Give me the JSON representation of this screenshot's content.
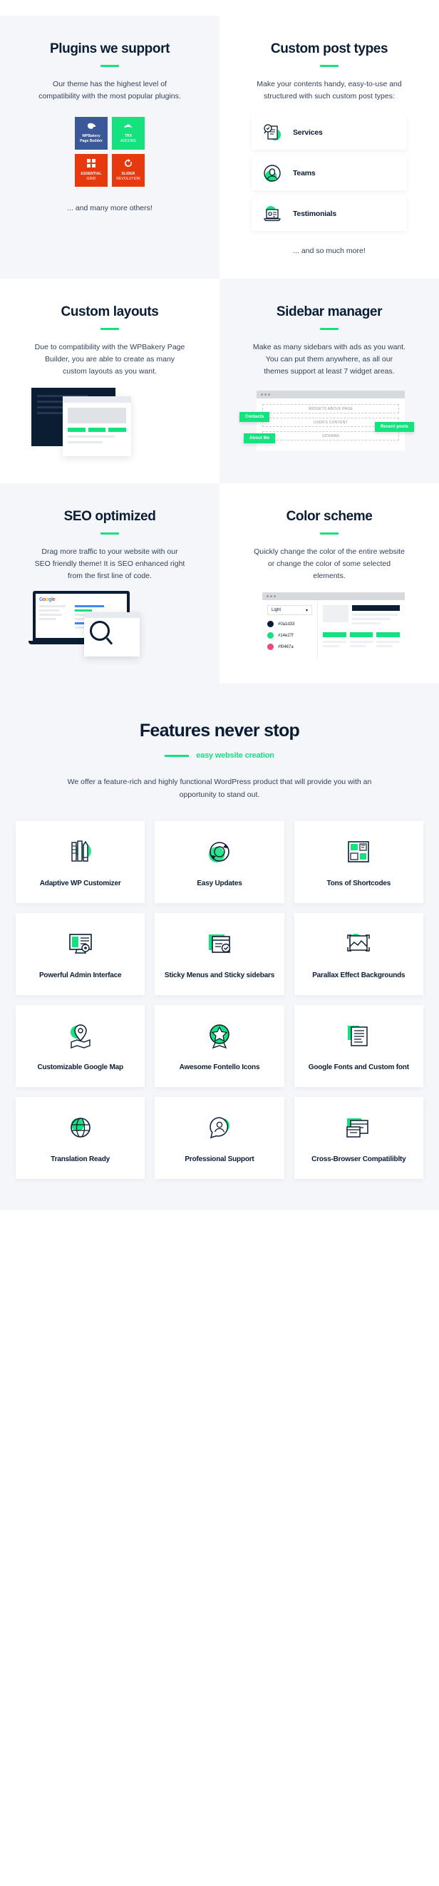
{
  "sections": {
    "plugins": {
      "title": "Plugins we support",
      "text": "Our theme has the highest level of compatibility with the most popular plugins.",
      "tiles": [
        {
          "name": "WPBakery",
          "sub": "Page Builder",
          "icon": "wpbakery-icon",
          "color": "#3b5998"
        },
        {
          "name": "TRX",
          "sub": "ADDONS",
          "icon": "trx-addons-icon",
          "color": "#14e27f"
        },
        {
          "name": "ESSENTIAL",
          "sub": "GRID",
          "icon": "essential-grid-icon",
          "color": "#e8380d"
        },
        {
          "name": "SLIDER",
          "sub": "REVOLUTION",
          "icon": "slider-revolution-icon",
          "color": "#e8380d"
        }
      ],
      "footnote": "... and many more others!"
    },
    "custom_post_types": {
      "title": "Custom post types",
      "text": "Make your contents handy, easy-to-use and structured with such custom post types:",
      "cards": [
        {
          "label": "Services",
          "icon": "services-document-icon"
        },
        {
          "label": "Teams",
          "icon": "teams-person-icon"
        },
        {
          "label": "Testimonials",
          "icon": "testimonials-laptop-icon"
        }
      ],
      "footnote": "... and so much more!"
    },
    "custom_layouts": {
      "title": "Custom layouts",
      "text": "Due to compatibility with the WPBakery Page Builder, you are able to create as many custom layouts as you want."
    },
    "sidebar_manager": {
      "title": "Sidebar manager",
      "text": "Make as many sidebars with ads as you want. You can put them anywhere, as all our themes support at least 7 widget areas.",
      "tags": [
        "Contacts",
        "Recent posts",
        "About Me"
      ],
      "widget_slots": [
        "WIDGETS ABOVE PAGE",
        "USER'S CONTENT",
        "SIDEBAR"
      ]
    },
    "seo": {
      "title": "SEO optimized",
      "text": "Drag more traffic to your website with our SEO friendly theme! It is SEO enhanced right from the first line of code.",
      "logo_letters": [
        "G",
        "o",
        "o",
        "g",
        "l",
        "e"
      ]
    },
    "color_scheme": {
      "title": "Color scheme",
      "text": "Quickly change the color of the entire website or change the color of some selected elements.",
      "select_value": "Light",
      "swatches": [
        {
          "hex": "#0a1d33",
          "label": "#0a1d33"
        },
        {
          "hex": "#14e27f",
          "label": "#14e27f"
        },
        {
          "hex": "#f0467a",
          "label": "#f0467a"
        }
      ]
    },
    "features": {
      "title": "Features never stop",
      "subtitle": "easy website creation",
      "lead": "We offer a feature-rich and highly functional WordPress product that will provide you with an opportunity to stand out.",
      "cards": [
        {
          "label": "Adaptive WP Customizer",
          "icon": "pencils-ruler-icon"
        },
        {
          "label": "Easy Updates",
          "icon": "refresh-arrows-icon"
        },
        {
          "label": "Tons of Shortcodes",
          "icon": "grid-blocks-icon"
        },
        {
          "label": "Powerful Admin Interface",
          "icon": "monitor-gear-icon"
        },
        {
          "label": "Sticky Menus and Sticky sidebars",
          "icon": "sticky-window-icon"
        },
        {
          "label": "Parallax Effect Backgrounds",
          "icon": "layers-stack-icon"
        },
        {
          "label": "Customizable Google Map",
          "icon": "map-pin-icon"
        },
        {
          "label": "Awesome Fontello Icons",
          "icon": "star-badge-icon"
        },
        {
          "label": "Google Fonts and Custom font",
          "icon": "text-page-icon"
        },
        {
          "label": "Translation Ready",
          "icon": "globe-icon"
        },
        {
          "label": "Professional Support",
          "icon": "support-chat-icon"
        },
        {
          "label": "Cross-Browser Compatiliblty",
          "icon": "browsers-icon"
        }
      ]
    }
  },
  "colors": {
    "accent": "#14e27f",
    "ink": "#0a1d33",
    "panel": "#f4f6f9"
  }
}
